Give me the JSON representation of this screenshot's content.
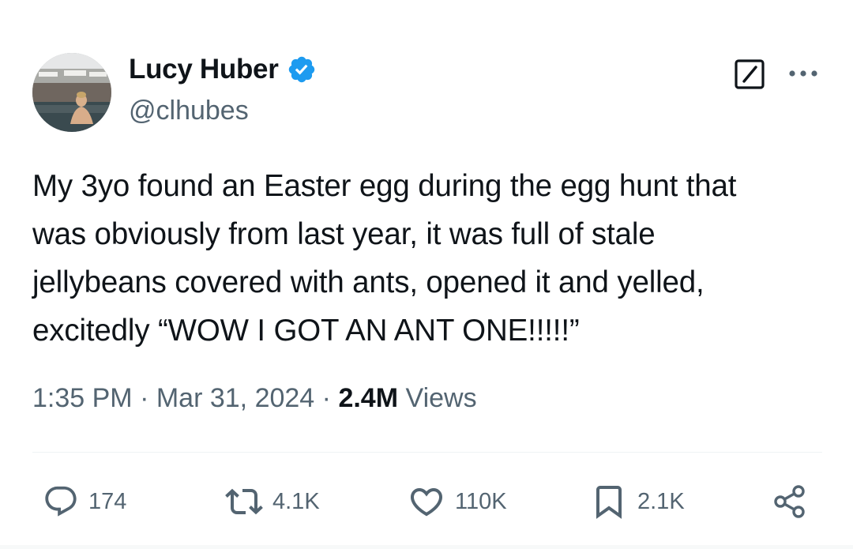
{
  "author": {
    "display_name": "Lucy Huber",
    "handle": "@clhubes",
    "verified": true,
    "verified_color": "#1d9bf0",
    "avatar_icon": "profile-photo"
  },
  "header_actions": {
    "grok_icon": "grok-icon",
    "more_icon": "more-icon"
  },
  "tweet": {
    "text": "My 3yo found an Easter egg during the egg hunt that\nwas obviously from last year, it was full of stale\njellybeans covered with ants, opened it and yelled,\nexcitedly “WOW I GOT AN ANT ONE!!!!!”",
    "time": "1:35 PM",
    "separator": "·",
    "date": "Mar 31, 2024",
    "views_count": "2.4M",
    "views_label": "Views"
  },
  "actions": {
    "replies": {
      "count": "174",
      "icon": "reply-icon"
    },
    "reposts": {
      "count": "4.1K",
      "icon": "repost-icon"
    },
    "likes": {
      "count": "110K",
      "icon": "like-icon"
    },
    "bookmarks": {
      "count": "2.1K",
      "icon": "bookmark-icon"
    },
    "share": {
      "icon": "share-icon"
    }
  },
  "colors": {
    "text_primary": "#0f1419",
    "text_secondary": "#536471",
    "divider": "#eff3f4"
  }
}
